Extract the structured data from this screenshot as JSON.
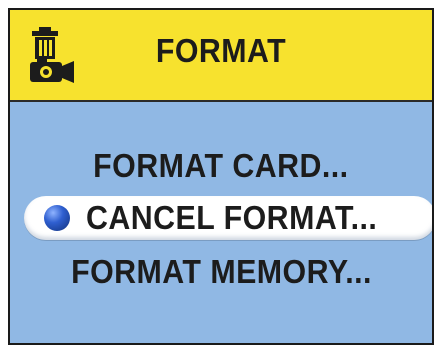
{
  "header": {
    "title": "FORMAT",
    "icon": "trash-camera-icon"
  },
  "menu": {
    "items": [
      {
        "label": "FORMAT CARD..."
      },
      {
        "label": "CANCEL FORMAT...",
        "selected": true
      },
      {
        "label": "FORMAT MEMORY..."
      }
    ]
  },
  "colors": {
    "header_bg": "#f7e22e",
    "body_bg": "#90b8e4",
    "selection_bg": "#ffffff",
    "bullet": "#2f5fd0"
  }
}
